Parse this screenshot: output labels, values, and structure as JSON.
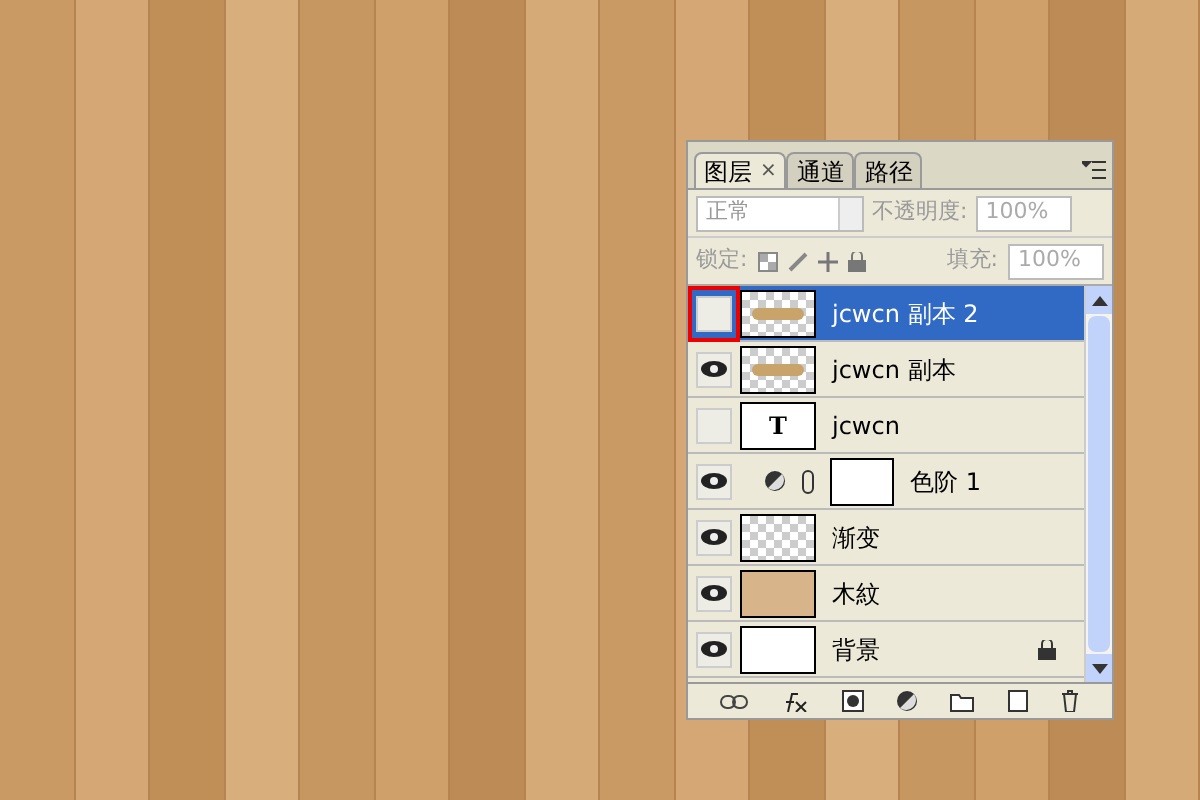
{
  "panel": {
    "tabs": [
      {
        "label": "图层",
        "selected": true,
        "close": "×"
      },
      {
        "label": "通道",
        "selected": false
      },
      {
        "label": "路径",
        "selected": false
      }
    ],
    "blend_mode": {
      "value": "正常",
      "disabled": true
    },
    "opacity": {
      "label": "不透明度:",
      "value": "100%",
      "disabled": true
    },
    "lock": {
      "label": "锁定:"
    },
    "fill": {
      "label": "填充:",
      "value": "100%",
      "disabled": true
    },
    "layers": [
      {
        "name": "jcwcn 副本 2",
        "visible": false,
        "selected": true,
        "highlighted": true,
        "kind": "shape",
        "locked": false
      },
      {
        "name": "jcwcn 副本",
        "visible": true,
        "selected": false,
        "highlighted": false,
        "kind": "shape",
        "locked": false
      },
      {
        "name": "jcwcn",
        "visible": false,
        "selected": false,
        "highlighted": false,
        "kind": "text",
        "thumb_text": "T",
        "locked": false
      },
      {
        "name": "色阶 1",
        "visible": true,
        "selected": false,
        "highlighted": false,
        "kind": "adjustment",
        "locked": false
      },
      {
        "name": "渐变",
        "visible": true,
        "selected": false,
        "highlighted": false,
        "kind": "gradient",
        "locked": false
      },
      {
        "name": "木紋",
        "visible": true,
        "selected": false,
        "highlighted": false,
        "kind": "wood",
        "locked": false
      },
      {
        "name": "背景",
        "visible": true,
        "selected": false,
        "highlighted": false,
        "kind": "white",
        "locked": true
      }
    ]
  }
}
